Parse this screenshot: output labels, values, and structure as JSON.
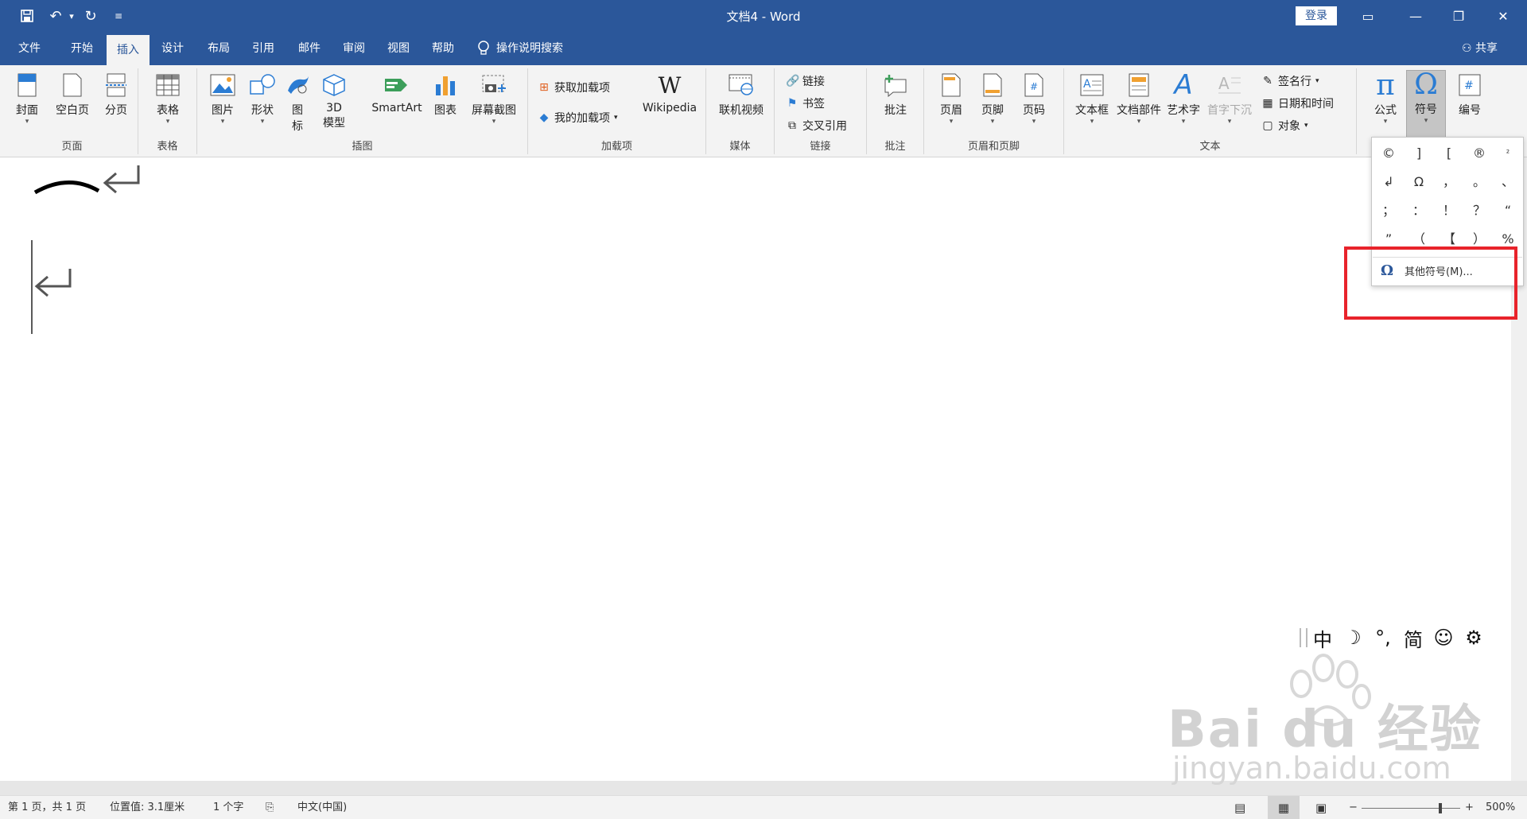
{
  "window": {
    "title": "文档4 - Word",
    "login_label": "登录"
  },
  "qat": {
    "save": "🖫",
    "undo": "↶",
    "undo_dd": "▾",
    "redo": "↻",
    "customize": "≡"
  },
  "window_controls": {
    "ribbon_display": "▭",
    "minimize": "—",
    "restore": "❐",
    "close": "✕"
  },
  "menu": {
    "tabs": [
      "文件",
      "开始",
      "插入",
      "设计",
      "布局",
      "引用",
      "邮件",
      "审阅",
      "视图",
      "帮助"
    ],
    "active": "插入",
    "tell_me": "操作说明搜索",
    "share": "共享"
  },
  "ribbon": {
    "groups": {
      "pages": "页面",
      "tables": "表格",
      "illustrations": "插图",
      "addins": "加载项",
      "media": "媒体",
      "links": "链接",
      "comments": "批注",
      "header_footer": "页眉和页脚",
      "text": "文本"
    },
    "pages": {
      "cover": "封面",
      "blank": "空白页",
      "break": "分页"
    },
    "tables": {
      "table": "表格"
    },
    "illustrations": {
      "pictures": "图片",
      "shapes": "形状",
      "icons_1": "图",
      "icons_2": "标",
      "model_1": "3D",
      "model_2": "模型",
      "smartart": "SmartArt",
      "chart": "图表",
      "screenshot": "屏幕截图"
    },
    "addins": {
      "get": "获取加载项",
      "my": "我的加载项",
      "wikipedia": "Wikipedia"
    },
    "media": {
      "online_video": "联机视频"
    },
    "links": {
      "link": "链接",
      "bookmark": "书签",
      "crossref": "交叉引用"
    },
    "comments": {
      "comment": "批注"
    },
    "header_footer": {
      "header": "页眉",
      "footer": "页脚",
      "page_number": "页码"
    },
    "text": {
      "textbox": "文本框",
      "quickparts": "文档部件",
      "wordart": "艺术字",
      "dropcap": "首字下沉",
      "signature": "签名行",
      "datetime": "日期和时间",
      "object": "对象"
    },
    "symbols": {
      "equation": "公式",
      "symbol": "符号",
      "number": "编号"
    }
  },
  "symbol_dropdown": {
    "symbols": [
      "©",
      "]",
      "[",
      "®",
      "²",
      "↲",
      "Ω",
      "，",
      "。",
      "、",
      "；",
      "：",
      "！",
      "？",
      "“",
      "”",
      "（",
      "【",
      "）",
      "%"
    ],
    "more_label": "其他符号(M)...",
    "omega": "Ω"
  },
  "ime": {
    "items": [
      "中",
      "☽",
      "°,",
      "简",
      "☺",
      "⚙"
    ]
  },
  "watermark": {
    "brand": "Bai du 经验",
    "url": "jingyan.baidu.com"
  },
  "status": {
    "page": "第 1 页，共 1 页",
    "position": "位置值: 3.1厘米",
    "words": "1 个字",
    "language": "中文(中国)",
    "zoom": "500%",
    "zoom_level": 0.8
  },
  "colors": {
    "accent": "#2b579a",
    "highlight": "#e8232b"
  }
}
